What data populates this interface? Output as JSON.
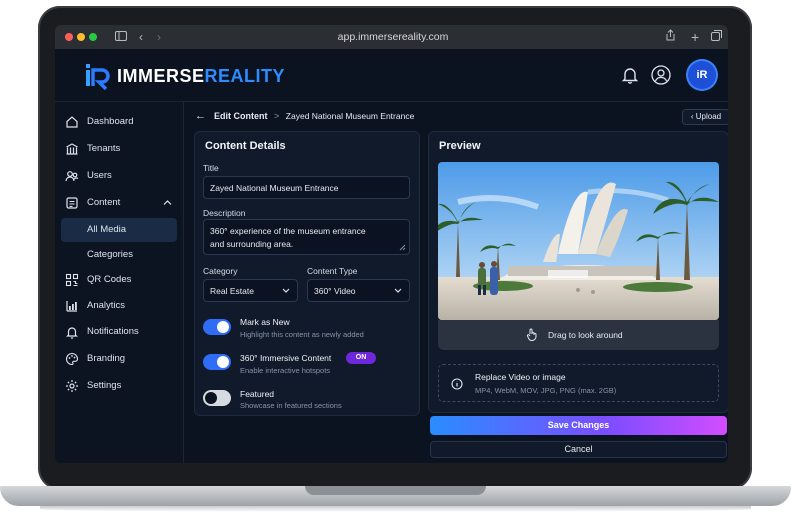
{
  "browser": {
    "url": "app.immersereality.com"
  },
  "app": {
    "logo_mark": "iR",
    "logo_text_1": "IMMERSE",
    "logo_text_2": "REALITY",
    "avatar_initials": "iR"
  },
  "sidebar": {
    "items": [
      {
        "label": "Dashboard",
        "icon": "home-icon"
      },
      {
        "label": "Tenants",
        "icon": "building-icon"
      },
      {
        "label": "Users",
        "icon": "users-icon"
      },
      {
        "label": "Content",
        "icon": "content-icon"
      },
      {
        "label": "All Media",
        "icon": ""
      },
      {
        "label": "Categories",
        "icon": ""
      },
      {
        "label": "QR Codes",
        "icon": "qr-icon"
      },
      {
        "label": "Analytics",
        "icon": "analytics-icon"
      },
      {
        "label": "Notifications",
        "icon": "bell-icon"
      },
      {
        "label": "Branding",
        "icon": "palette-icon"
      },
      {
        "label": "Settings",
        "icon": "gear-icon"
      }
    ]
  },
  "breadcrumb": {
    "current": "Edit Content",
    "separator": ">",
    "item": "Zayed National Museum Entrance"
  },
  "upload_label": "Upload",
  "details": {
    "heading": "Content Details",
    "title_label": "Title",
    "title_value": "Zayed National Museum Entrance",
    "description_label": "Description",
    "description_line1": "360° experience of the museum entrance",
    "description_line2": "and surrounding area.",
    "category_label": "Category",
    "category_value": "Real Estate",
    "content_type_label": "Content Type",
    "content_type_value": "360° Video",
    "toggles": [
      {
        "title": "Mark as New",
        "subtitle": "Highlight this content as newly added",
        "on": true
      },
      {
        "title": "360° Immersive Content",
        "subtitle": "Enable interactive hotspots",
        "on": true,
        "badge": "ON"
      },
      {
        "title": "Featured",
        "subtitle": "Showcase in featured sections",
        "on": false
      }
    ]
  },
  "preview": {
    "heading": "Preview",
    "drag_hint": "Drag to look around",
    "replace_title": "Replace Video or image",
    "replace_sub": "MP4, WebM, MOV, JPG, PNG (max. 2GB)"
  },
  "actions": {
    "save": "Save Changes",
    "cancel": "Cancel"
  },
  "colors": {
    "accent": "#2f8cff",
    "toggle_on": "#2f6df6",
    "badge": "#6d28d9"
  }
}
